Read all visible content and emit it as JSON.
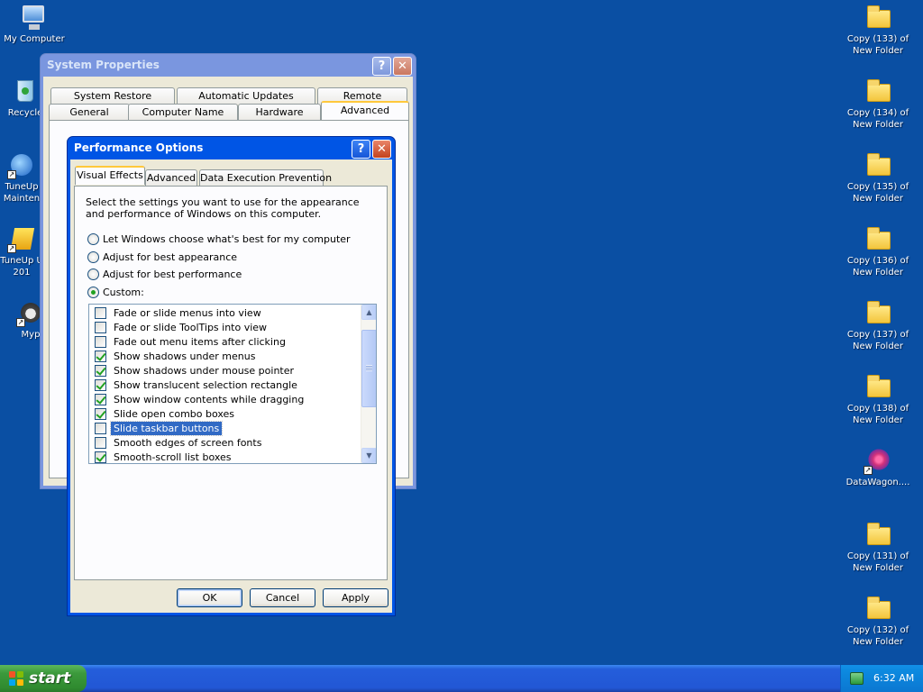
{
  "desktop": {
    "left_icons": [
      {
        "label": "My Computer"
      },
      {
        "label": "Recycle"
      },
      {
        "label": "TuneUp\nMainten"
      },
      {
        "label": "TuneUp U\n201"
      },
      {
        "label": "Myp"
      }
    ],
    "right_icons": [
      {
        "label": "Copy (133) of\nNew Folder"
      },
      {
        "label": "Copy (134) of\nNew Folder"
      },
      {
        "label": "Copy (135) of\nNew Folder"
      },
      {
        "label": "Copy (136) of\nNew Folder"
      },
      {
        "label": "Copy (137) of\nNew Folder"
      },
      {
        "label": "Copy (138) of\nNew Folder"
      },
      {
        "label": "DataWagon...."
      },
      {
        "label": "Copy (131) of\nNew Folder"
      },
      {
        "label": "Copy (132) of\nNew Folder"
      }
    ]
  },
  "system_properties": {
    "title": "System Properties",
    "tabs_row1": [
      "System Restore",
      "Automatic Updates",
      "Remote"
    ],
    "tabs_row2": [
      "General",
      "Computer Name",
      "Hardware",
      "Advanced"
    ],
    "active_tab": "Advanced"
  },
  "performance_options": {
    "title": "Performance Options",
    "tabs": [
      "Visual Effects",
      "Advanced",
      "Data Execution Prevention"
    ],
    "active_tab": "Visual Effects",
    "description": "Select the settings you want to use for the appearance and performance of Windows on this computer.",
    "radio_options": [
      {
        "label": "Let Windows choose what's best for my computer",
        "selected": false
      },
      {
        "label": "Adjust for best appearance",
        "selected": false
      },
      {
        "label": "Adjust for best performance",
        "selected": false
      },
      {
        "label": "Custom:",
        "selected": true
      }
    ],
    "effects": [
      {
        "label": "Fade or slide menus into view",
        "checked": false,
        "selected": false
      },
      {
        "label": "Fade or slide ToolTips into view",
        "checked": false,
        "selected": false
      },
      {
        "label": "Fade out menu items after clicking",
        "checked": false,
        "selected": false
      },
      {
        "label": "Show shadows under menus",
        "checked": true,
        "selected": false
      },
      {
        "label": "Show shadows under mouse pointer",
        "checked": true,
        "selected": false
      },
      {
        "label": "Show translucent selection rectangle",
        "checked": true,
        "selected": false
      },
      {
        "label": "Show window contents while dragging",
        "checked": true,
        "selected": false
      },
      {
        "label": "Slide open combo boxes",
        "checked": true,
        "selected": false
      },
      {
        "label": "Slide taskbar buttons",
        "checked": false,
        "selected": true
      },
      {
        "label": "Smooth edges of screen fonts",
        "checked": false,
        "selected": false
      },
      {
        "label": "Smooth-scroll list boxes",
        "checked": true,
        "selected": false
      }
    ],
    "buttons": {
      "ok": "OK",
      "cancel": "Cancel",
      "apply": "Apply"
    }
  },
  "taskbar": {
    "start_label": "start",
    "clock": "6:32 AM"
  }
}
